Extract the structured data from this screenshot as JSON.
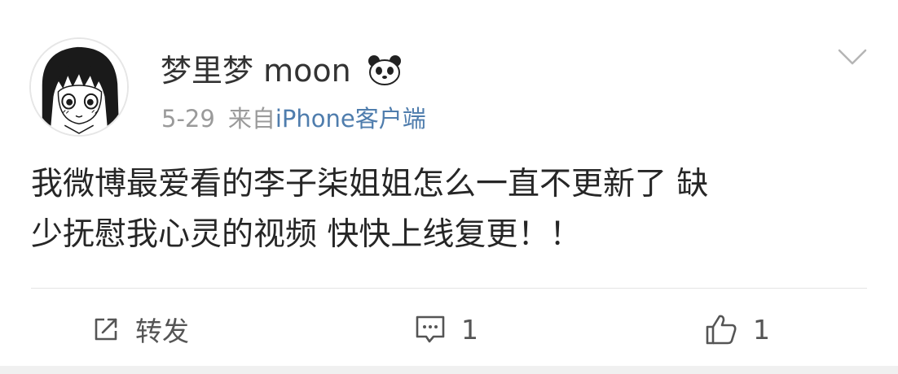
{
  "post": {
    "author": {
      "name": "梦里梦 moon"
    },
    "meta": {
      "date": "5-29",
      "source_prefix": "来自",
      "source_device": "iPhone客户端"
    },
    "content": "我微博最爱看的李子柒姐姐怎么一直不更新了 缺\n少抚慰我心灵的视频 快快上线复更！！"
  },
  "actions": {
    "repost": {
      "label": "转发",
      "icon": "repost-icon"
    },
    "comment": {
      "count": "1",
      "icon": "comment-icon"
    },
    "like": {
      "count": "1",
      "icon": "thumbs-up-icon"
    }
  },
  "colors": {
    "text": "#333333",
    "meta": "#9a9a9a",
    "link": "#4f7dad",
    "divider": "#e4e4e4"
  }
}
